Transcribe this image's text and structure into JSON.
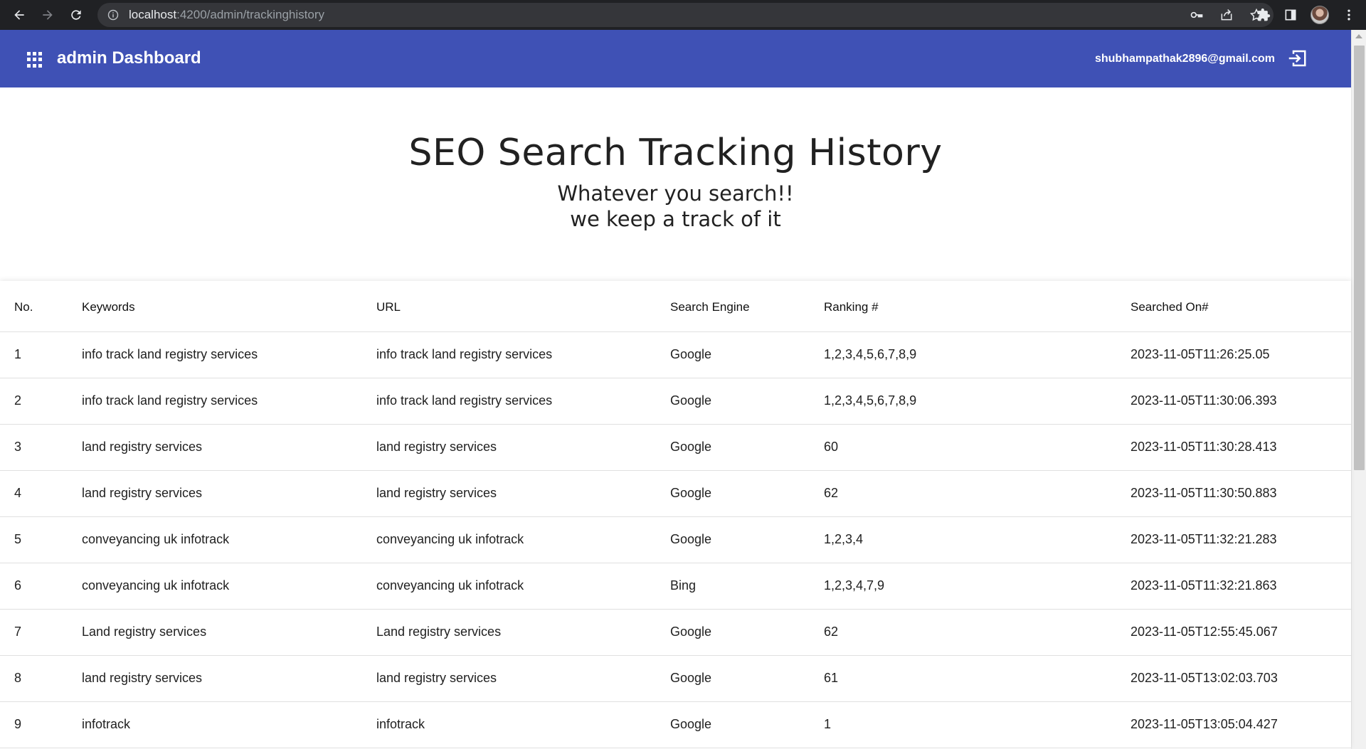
{
  "browser": {
    "url_host": "localhost",
    "url_path": ":4200/admin/trackinghistory"
  },
  "toolbar": {
    "title": "admin Dashboard",
    "user_email": "shubhampathak2896@gmail.com",
    "accent_color": "#3f51b5"
  },
  "hero": {
    "title": "SEO Search Tracking History",
    "subtitle_line1": "Whatever you search!!",
    "subtitle_line2": "we keep a track of it"
  },
  "table": {
    "headers": {
      "no": "No.",
      "keywords": "Keywords",
      "url": "URL",
      "search_engine": "Search Engine",
      "ranking": "Ranking #",
      "searched_on": "Searched On#"
    },
    "rows": [
      {
        "no": "1",
        "keywords": "info track land registry services",
        "url": "info track land registry services",
        "search_engine": "Google",
        "ranking": "1,2,3,4,5,6,7,8,9",
        "searched_on": "2023-11-05T11:26:25.05"
      },
      {
        "no": "2",
        "keywords": "info track land registry services",
        "url": "info track land registry services",
        "search_engine": "Google",
        "ranking": "1,2,3,4,5,6,7,8,9",
        "searched_on": "2023-11-05T11:30:06.393"
      },
      {
        "no": "3",
        "keywords": "land registry services",
        "url": "land registry services",
        "search_engine": "Google",
        "ranking": "60",
        "searched_on": "2023-11-05T11:30:28.413"
      },
      {
        "no": "4",
        "keywords": "land registry services",
        "url": "land registry services",
        "search_engine": "Google",
        "ranking": "62",
        "searched_on": "2023-11-05T11:30:50.883"
      },
      {
        "no": "5",
        "keywords": "conveyancing uk infotrack",
        "url": "conveyancing uk infotrack",
        "search_engine": "Google",
        "ranking": "1,2,3,4",
        "searched_on": "2023-11-05T11:32:21.283"
      },
      {
        "no": "6",
        "keywords": "conveyancing uk infotrack",
        "url": "conveyancing uk infotrack",
        "search_engine": "Bing",
        "ranking": "1,2,3,4,7,9",
        "searched_on": "2023-11-05T11:32:21.863"
      },
      {
        "no": "7",
        "keywords": "Land registry services",
        "url": "Land registry services",
        "search_engine": "Google",
        "ranking": "62",
        "searched_on": "2023-11-05T12:55:45.067"
      },
      {
        "no": "8",
        "keywords": "land registry services",
        "url": "land registry services",
        "search_engine": "Google",
        "ranking": "61",
        "searched_on": "2023-11-05T13:02:03.703"
      },
      {
        "no": "9",
        "keywords": "infotrack",
        "url": "infotrack",
        "search_engine": "Google",
        "ranking": "1",
        "searched_on": "2023-11-05T13:05:04.427"
      }
    ]
  }
}
